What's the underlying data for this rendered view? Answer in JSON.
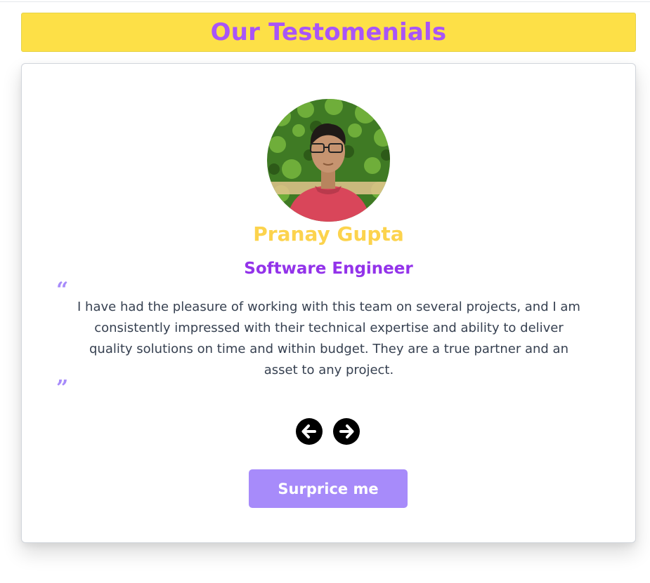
{
  "header": {
    "title": "Our Testomenials"
  },
  "testimonial": {
    "name": "Pranay Gupta",
    "role": "Software Engineer",
    "quote": "I have had the pleasure of working with this team on several projects, and I am consistently impressed with their technical expertise and ability to deliver quality solutions on time and within budget. They are a true partner and an asset to any project.",
    "open_quote_glyph": "“",
    "close_quote_glyph": "”"
  },
  "controls": {
    "prev_icon": "arrow-left-circle-icon",
    "next_icon": "arrow-right-circle-icon",
    "surprise_label": "Surprice me"
  },
  "colors": {
    "banner_bg": "#fde047",
    "title": "#a855f7",
    "name": "#fcd34d",
    "role": "#9333ea",
    "quote_marks": "#a78bfa",
    "button_bg": "#a78bfa"
  }
}
